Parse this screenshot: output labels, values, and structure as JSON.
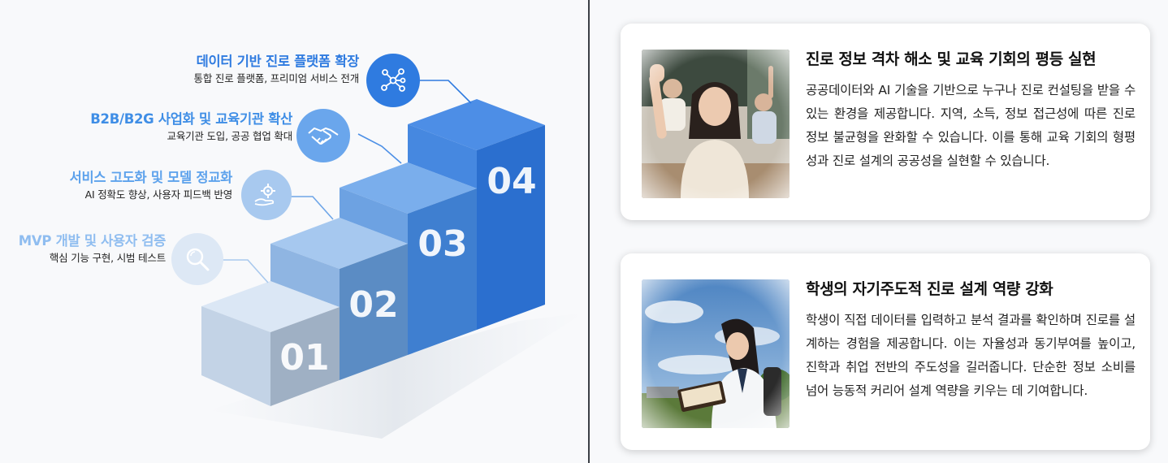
{
  "stages": [
    {
      "num": "01",
      "title": "MVP 개발 및 사용자 검증",
      "desc": "핵심 기능 구현, 시범 테스트",
      "icon": "magnifier-icon",
      "color": "#8fbdf0"
    },
    {
      "num": "02",
      "title": "서비스 고도화 및 모델 정교화",
      "desc": "AI 정확도 향상, 사용자 피드백 반영",
      "icon": "hand-gear-icon",
      "color": "#5da2ec"
    },
    {
      "num": "03",
      "title": "B2B/B2G 사업화 및 교육기관 확산",
      "desc": "교육기관 도입, 공공 협업 확대",
      "icon": "handshake-icon",
      "color": "#3f8ee6"
    },
    {
      "num": "04",
      "title": "데이터 기반 진로 플랫폼 확장",
      "desc": "통합 진로 플랫폼, 프리미엄 서비스 전개",
      "icon": "network-icon",
      "color": "#2f7be0"
    }
  ],
  "cards": [
    {
      "title": "진로 정보 격차 해소 및 교육 기회의 평등 실현",
      "body": "공공데이터와 AI 기술을 기반으로 누구나 진로 컨설팅을 받을 수 있는 환경을 제공합니다. 지역, 소득, 정보 접근성에 따른 진로 정보 불균형을 완화할 수 있습니다. 이를 통해 교육 기회의 형평성과 진로 설계의 공공성을 실현할 수 있습니다.",
      "image": "classroom-students-photo"
    },
    {
      "title": "학생의 자기주도적 진로 설계 역량 강화",
      "body": "학생이 직접 데이터를 입력하고 분석 결과를 확인하며 진로를 설계하는 경험을 제공합니다. 이는 자율성과 동기부여를 높이고, 진학과 취업 전반의 주도성을 길러줍니다. 단순한 정보 소비를 넘어 능동적 커리어 설계 역량을 키우는 데 기여합니다.",
      "image": "student-outdoors-photo"
    }
  ]
}
